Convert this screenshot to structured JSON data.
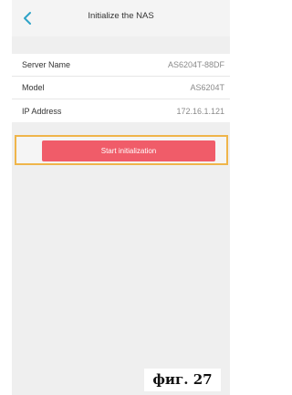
{
  "colors": {
    "accent": "#2ea3c7",
    "button": "#f05c69",
    "highlight_border": "#efb54a",
    "background": "#efefef"
  },
  "header": {
    "back_icon": "chevron-left-icon",
    "title": "Initialize the NAS"
  },
  "info": {
    "rows": [
      {
        "label": "Server Name",
        "value": "AS6204T-88DF"
      },
      {
        "label": "Model",
        "value": "AS6204T"
      },
      {
        "label": "IP Address",
        "value": "172.16.1.121"
      }
    ]
  },
  "actions": {
    "start_label": "Start initialization"
  },
  "caption": "фиг. 27"
}
